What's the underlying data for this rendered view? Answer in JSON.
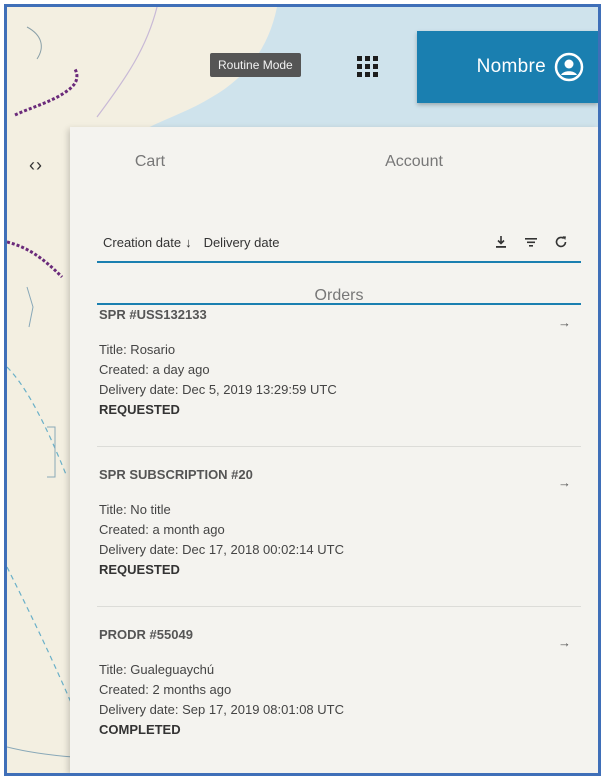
{
  "topbar": {
    "mode_label": "Routine Mode",
    "user_name": "Nombre"
  },
  "edge": {
    "chevrons": "‹›"
  },
  "tabs": [
    {
      "label": "Cart"
    },
    {
      "label": "Orders",
      "active": true
    },
    {
      "label": "Account"
    }
  ],
  "sort": {
    "creation_label": "Creation date",
    "creation_arrow": "↓",
    "delivery_label": "Delivery date"
  },
  "actions": {
    "download_icon": "download-icon",
    "filter_icon": "filter-icon",
    "refresh_icon": "refresh-icon"
  },
  "orders": [
    {
      "id": "SPR #USS132133",
      "title": "Title: Rosario",
      "created": "Created: a day ago",
      "delivery": "Delivery date: Dec 5, 2019 13:29:59 UTC",
      "status": "REQUESTED"
    },
    {
      "id": "SPR SUBSCRIPTION #20",
      "title": "Title: No title",
      "created": "Created: a month ago",
      "delivery": "Delivery date: Dec 17, 2018 00:02:14 UTC",
      "status": "REQUESTED"
    },
    {
      "id": "PRODR #55049",
      "title": "Title: Gualeguaychú",
      "created": "Created: 2 months ago",
      "delivery": "Delivery date: Sep 17, 2019 08:01:08 UTC",
      "status": "COMPLETED"
    }
  ],
  "arrow_glyph": "→",
  "colors": {
    "accent": "#1a7fb0",
    "panel": "#f4f3ef",
    "frame": "#3f6fb8",
    "map_water": "#cfe3ec",
    "map_land": "#f3efe1"
  }
}
